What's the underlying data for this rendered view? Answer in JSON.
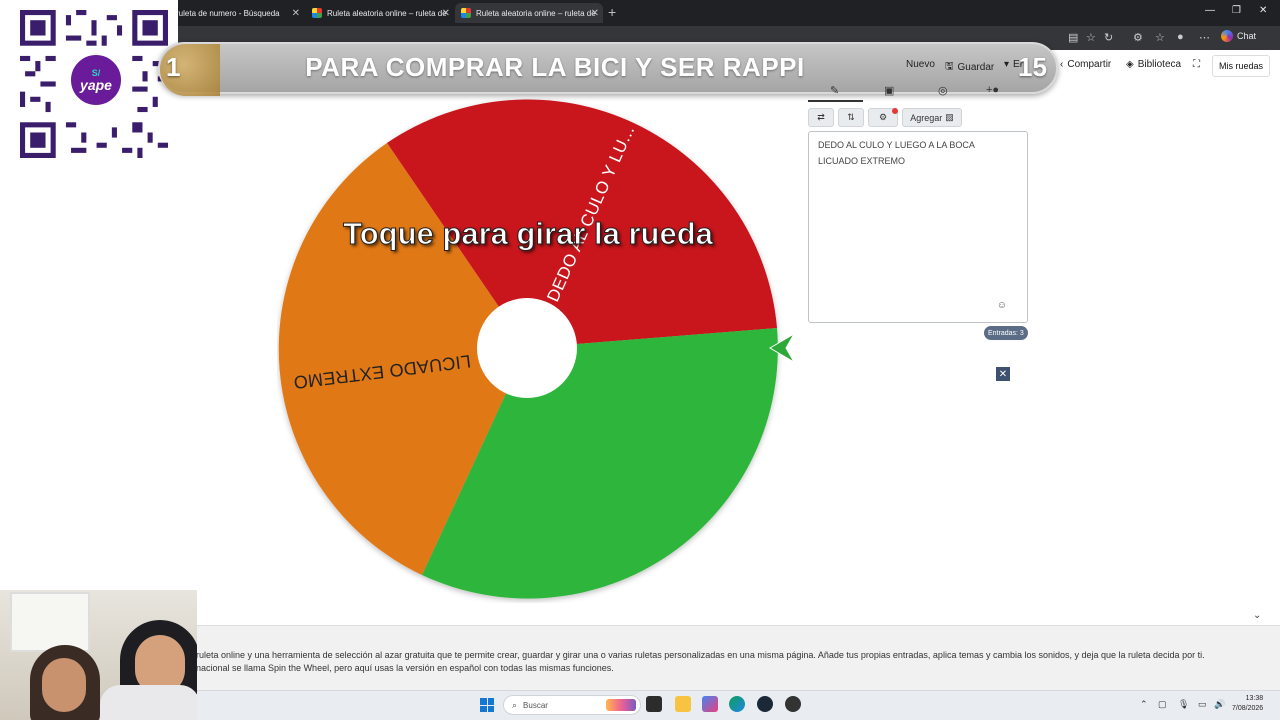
{
  "browser": {
    "tabs": [
      {
        "title": "ruleta de numero - Búsqueda",
        "active": false
      },
      {
        "title": "Ruleta aleatoria online – ruleta de",
        "active": false
      },
      {
        "title": "Ruleta aleatoria online – ruleta de",
        "active": true
      }
    ],
    "chat_label": "Chat"
  },
  "overlay": {
    "qr_badge_top": "S/",
    "qr_badge_brand": "yape"
  },
  "goal": {
    "current": "1",
    "title": "PARA COMPRAR LA BICI Y SER RAPPI",
    "total": "15"
  },
  "app_nav": {
    "nuevo": "Nuevo",
    "guardar": "Guardar",
    "truncated": "Er",
    "compartir": "Compartir",
    "biblioteca": "Biblioteca",
    "mis_ruedas": "Mis ruedas"
  },
  "wheel": {
    "overlay_text": "Toque para girar la rueda",
    "segments": [
      {
        "label": "DEDO AL CULO Y LU...",
        "color": "#c8141e"
      },
      {
        "label": "",
        "color": "#2db53a"
      },
      {
        "label": "LICUADO EXTREMO",
        "color": "#e07818"
      }
    ],
    "pointer_color": "#2fa83a"
  },
  "editor": {
    "agregar_label": "Agregar",
    "entries": [
      "DEDO AL CULO Y LUEGO A LA BOCA",
      "LICUADO EXTREMO"
    ],
    "entradas_label": "Entradas: 3",
    "close_label": "✕"
  },
  "description": {
    "line1": "ruleta online y una herramienta de selección al azar gratuita que te permite crear, guardar y girar una o varias ruletas personalizadas en una misma página. Añade tus propias entradas, aplica temas y cambia los sonidos, y deja que la ruleta decida por ti.",
    "line2": "nacional se llama Spin the Wheel, pero aquí usas la versión en español con todas las mismas funciones."
  },
  "taskbar": {
    "search_placeholder": "Buscar",
    "time": "13:38",
    "date": "7/08/2026"
  }
}
